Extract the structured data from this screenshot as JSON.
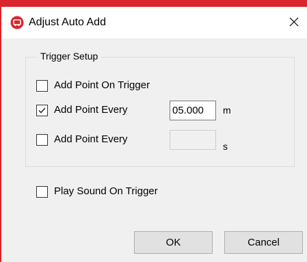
{
  "window": {
    "title": "Adjust Auto Add",
    "icon": "red-circle-app-icon",
    "close_icon": "close-icon",
    "accent_color": "#d9262c"
  },
  "trigger_setup": {
    "legend": "Trigger Setup",
    "add_point_on_trigger": {
      "label": "Add Point On Trigger",
      "checked": false
    },
    "add_point_every_distance": {
      "label": "Add Point Every",
      "checked": true,
      "value": "05.000",
      "unit": "m"
    },
    "add_point_every_time": {
      "label": "Add Point Every",
      "checked": false,
      "value": "",
      "unit": "s"
    }
  },
  "play_sound_on_trigger": {
    "label": "Play Sound On Trigger",
    "checked": false
  },
  "buttons": {
    "ok_label": "OK",
    "cancel_label": "Cancel"
  }
}
